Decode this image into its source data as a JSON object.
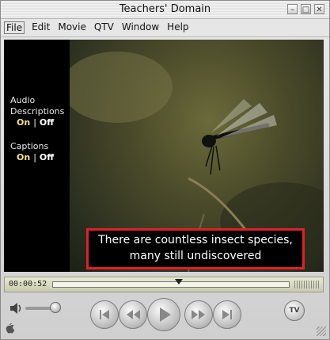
{
  "window": {
    "title": "Teachers' Domain"
  },
  "window_controls": {
    "minimize": "–",
    "maximize": "□",
    "close": "✕"
  },
  "menu": [
    "File",
    "Edit",
    "Movie",
    "QTV",
    "Window",
    "Help"
  ],
  "side_panel": {
    "audio_label_1": "Audio",
    "audio_label_2": "Descriptions",
    "audio_on": "On",
    "audio_sep": "|",
    "audio_off": "Off",
    "captions_label": "Captions",
    "captions_on": "On",
    "captions_sep": "|",
    "captions_off": "Off"
  },
  "caption": {
    "line1": "There are countless insect species,",
    "line2": "many still undiscovered"
  },
  "playback": {
    "timecode": "00:00:52",
    "position_fraction": 0.53
  },
  "controls": {
    "tv_label": "TV",
    "icons": [
      "speaker-icon",
      "step-back-icon",
      "rewind-icon",
      "play-icon",
      "fast-forward-icon",
      "step-forward-icon"
    ]
  },
  "colors": {
    "caption_border": "#e0202a",
    "on_highlight": "#f3e08a"
  }
}
